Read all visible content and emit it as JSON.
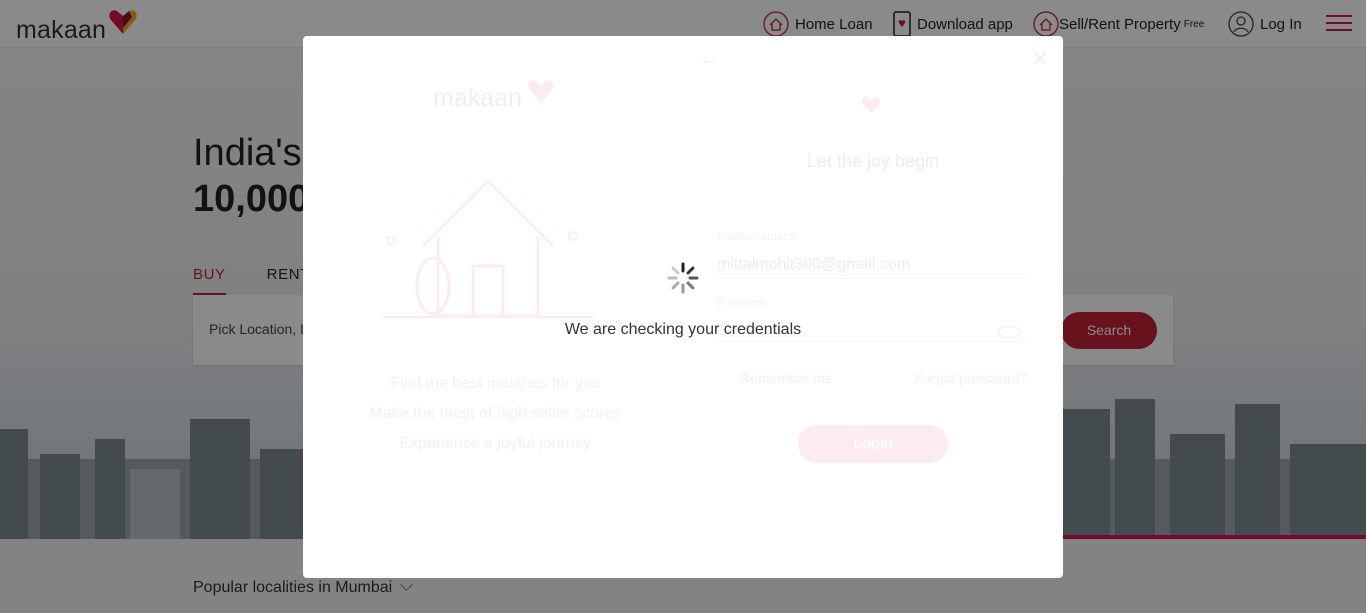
{
  "header": {
    "logo_text": "makaan",
    "nav": {
      "home_loan": "Home Loan",
      "download_app": "Download app",
      "sell_rent": "Sell/Rent Property",
      "sell_rent_badge": "Free",
      "login": "Log In"
    }
  },
  "hero": {
    "title_line1": "India's",
    "title_line2": "10,000",
    "tabs": [
      "BUY",
      "RENT"
    ],
    "active_tab": "BUY",
    "search_placeholder": "Pick Location, I",
    "search_button": "Search"
  },
  "popular": {
    "label": "Popular localities in Mumbai"
  },
  "modal": {
    "logo_text": "makaan",
    "taglines": [
      "Find the best matches for you",
      "Make the most of high seller scores",
      "Experience a joyful journey"
    ],
    "heading": "Let the joy begin",
    "email_label": "Email/Username",
    "email_value": "mittalmohit300@gmail.com",
    "password_label": "Password",
    "remember_me": "Remember me",
    "forgot_password": "Forgot password?",
    "login_button": "Login",
    "status_text": "We are checking your credentials"
  },
  "colors": {
    "brand_red": "#c12238",
    "brand_pink": "#d3164a",
    "overlay": "rgba(0,0,0,0.46)"
  }
}
